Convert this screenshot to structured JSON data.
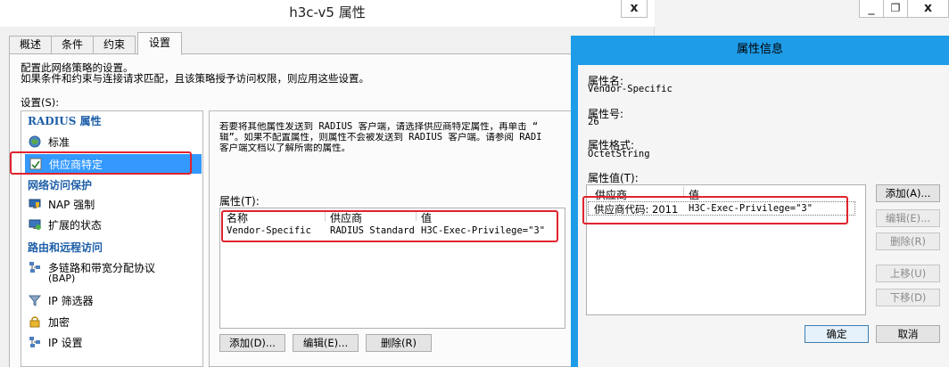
{
  "main_window": {
    "title": "h3c-v5 属性",
    "close_label": "x",
    "tabs": [
      "概述",
      "条件",
      "约束",
      "设置"
    ],
    "description_line1": "配置此网络策略的设置。",
    "description_line2": "如果条件和约束与连接请求匹配，且该策略授予访问权限，则应用这些设置。",
    "settings_label": "设置(S):",
    "tree": {
      "heading_radius": "RADIUS 属性",
      "standard": "标准",
      "vendor_specific": "供应商特定",
      "heading_nap": "网络访问保护",
      "nap_enforcement": "NAP 强制",
      "extended_state": "扩展的状态",
      "heading_routing": "路由和远程访问",
      "multilink_line1": "多链路和带宽分配协议",
      "multilink_line2": "(BAP)",
      "ip_filters": "IP 筛选器",
      "encryption": "加密",
      "ip_settings": "IP 设置"
    },
    "right_desc_line1": "若要将其他属性发送到 RADIUS 客户端，请选择供应商特定属性，再单击 “",
    "right_desc_line2": "辑”。如果不配置属性，则属性不会被发送到 RADIUS 客户端。请参阅 RADI",
    "right_desc_line3": "客户端文档以了解所需的属性。",
    "attributes_label": "属性(T):",
    "columns": [
      "名称",
      "供应商",
      "值"
    ],
    "row": {
      "name": "Vendor-Specific",
      "vendor": "RADIUS Standard",
      "value": "H3C-Exec-Privilege=\"3\""
    },
    "buttons": {
      "add": "添加(D)...",
      "edit": "编辑(E)...",
      "delete": "删除(R)"
    }
  },
  "bg_window": {
    "minimize": "_",
    "restore": "❐",
    "close": "x"
  },
  "popup": {
    "title": "属性信息",
    "attr_name_label": "属性名:",
    "attr_name_value": "Vendor-Specific",
    "attr_number_label": "属性号:",
    "attr_number_value": "26",
    "attr_format_label": "属性格式:",
    "attr_format_value": "OctetString",
    "attr_values_label": "属性值(T):",
    "columns": [
      "供应商",
      "值"
    ],
    "row": {
      "vendor": "供应商代码: 2011",
      "value": "H3C-Exec-Privilege=\"3\""
    },
    "buttons": {
      "add": "添加(A)...",
      "edit": "编辑(E)...",
      "delete": "删除(R)",
      "move_up": "上移(U)",
      "move_down": "下移(D)",
      "ok": "确定",
      "cancel": "取消"
    }
  },
  "colors": {
    "highlight_red": "#e0232e",
    "selection_blue": "#3399ff",
    "popup_frame": "#1e9ce8",
    "tree_heading": "#1e5fa8"
  }
}
